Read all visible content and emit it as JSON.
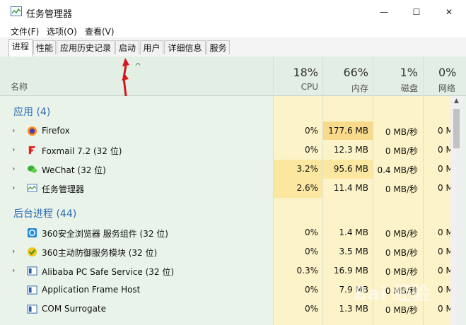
{
  "window": {
    "title": "任务管理器"
  },
  "window_buttons": {
    "minimize": "—",
    "maximize": "☐",
    "close": "✕"
  },
  "menu": [
    "文件(F)",
    "选项(O)",
    "查看(V)"
  ],
  "tabs": [
    "进程",
    "性能",
    "应用历史记录",
    "启动",
    "用户",
    "详细信息",
    "服务"
  ],
  "active_tab": "进程",
  "header": {
    "name_label": "名称",
    "sort_indicator": "^",
    "columns": [
      {
        "pct": "18%",
        "label": "CPU"
      },
      {
        "pct": "66%",
        "label": "内存"
      },
      {
        "pct": "1%",
        "label": "磁盘"
      },
      {
        "pct": "0%",
        "label": "网络"
      }
    ]
  },
  "groups": [
    {
      "title": "应用 (4)"
    },
    {
      "title": "后台进程 (44)"
    }
  ],
  "apps": [
    {
      "name": "Firefox",
      "cpu": "0%",
      "mem": "177.6 MB",
      "disk": "0 MB/秒",
      "net": "0 M",
      "icon": "firefox-icon"
    },
    {
      "name": "Foxmail 7.2 (32 位)",
      "cpu": "0%",
      "mem": "12.3 MB",
      "disk": "0 MB/秒",
      "net": "0 M",
      "icon": "foxmail-icon"
    },
    {
      "name": "WeChat (32 位)",
      "cpu": "3.2%",
      "mem": "95.6 MB",
      "disk": "0.4 MB/秒",
      "net": "0 M",
      "icon": "wechat-icon"
    },
    {
      "name": "任务管理器",
      "cpu": "2.6%",
      "mem": "11.4 MB",
      "disk": "0 MB/秒",
      "net": "0 M",
      "icon": "taskmgr-icon"
    }
  ],
  "background": [
    {
      "name": "360安全浏览器 服务组件 (32 位)",
      "cpu": "0%",
      "mem": "1.4 MB",
      "disk": "0 MB/秒",
      "net": "0 M",
      "icon": "360browser-icon",
      "expandable": false
    },
    {
      "name": "360主动防御服务模块 (32 位)",
      "cpu": "0%",
      "mem": "3.5 MB",
      "disk": "0 MB/秒",
      "net": "0 M",
      "icon": "360defense-icon",
      "expandable": true
    },
    {
      "name": "Alibaba PC Safe Service (32 位)",
      "cpu": "0.3%",
      "mem": "16.9 MB",
      "disk": "0 MB/秒",
      "net": "0 M",
      "icon": "alibaba-icon",
      "expandable": true
    },
    {
      "name": "Application Frame Host",
      "cpu": "0%",
      "mem": "7.9 MB",
      "disk": "0 MB/秒",
      "net": "0 M",
      "icon": "app-frame-icon",
      "expandable": false
    },
    {
      "name": "COM Surrogate",
      "cpu": "0%",
      "mem": "1.3 MB",
      "disk": "0 MB/秒",
      "net": "0 M",
      "icon": "com-surrogate-icon",
      "expandable": false
    }
  ],
  "watermark": "Bai 经验",
  "colors": {
    "accent_group": "#2f6db5",
    "heat_light": "#fdf3c8",
    "heat_mid": "#fbe7a0",
    "heat_strong": "#f9d98a",
    "bg": "#e9f3ea",
    "arrow": "#d9161c"
  }
}
